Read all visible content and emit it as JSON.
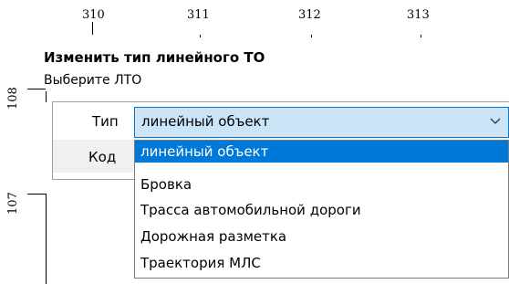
{
  "ruler": {
    "x_ticks": [
      "310",
      "311",
      "312",
      "313"
    ],
    "y_ticks": [
      "108",
      "107"
    ]
  },
  "dialog": {
    "title": "Изменить тип линейного ТО",
    "subtitle": "Выберите ЛТО"
  },
  "form": {
    "type_label": "Тип",
    "code_label": "Код",
    "type_value": "линейный объект",
    "options": [
      "линейный объект",
      "Бровка",
      "Трасса автомобильной дороги",
      "Дорожная разметка",
      "Траектория МЛС"
    ],
    "selected_index": 0
  },
  "colors": {
    "selection": "#0078d7",
    "select_bg": "#cce4f7"
  },
  "icons": {
    "dropdown_arrow": "chevron-down-icon"
  }
}
